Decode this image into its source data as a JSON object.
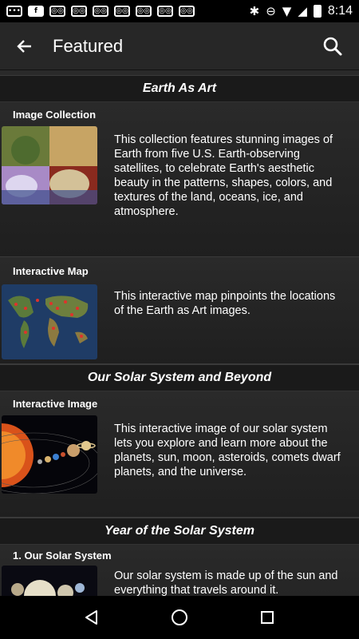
{
  "status_bar": {
    "time": "8:14",
    "notification_icons": [
      "chat-icon",
      "facebook-icon",
      "media-icon",
      "media-icon",
      "media-icon",
      "media-icon",
      "media-icon",
      "media-icon",
      "media-icon",
      "media-icon"
    ]
  },
  "app_bar": {
    "title": "Featured"
  },
  "sections": [
    {
      "title": "Earth As Art",
      "items": [
        {
          "label": "Image Collection",
          "description": "This collection features stunning images of Earth from five U.S. Earth-observing satellites, to celebrate Earth's aesthetic beauty in the patterns, shapes, colors, and textures of the land, oceans, ice, and atmosphere."
        },
        {
          "label": "Interactive Map",
          "description": "This interactive map pinpoints the locations of the Earth as Art images."
        }
      ]
    },
    {
      "title": "Our Solar System and Beyond",
      "items": [
        {
          "label": "Interactive Image",
          "description": "This interactive image of our solar system lets you explore and learn more about the planets, sun, moon, asteroids, comets dwarf planets, and the universe."
        }
      ]
    },
    {
      "title": "Year of the Solar System",
      "items": [
        {
          "label": "1. Our Solar System",
          "description": "Our solar system is made up of the sun and everything that travels around it."
        }
      ]
    }
  ],
  "colors": {
    "background": "#222222",
    "appbar": "#272727",
    "header": "#1a1a1a"
  }
}
